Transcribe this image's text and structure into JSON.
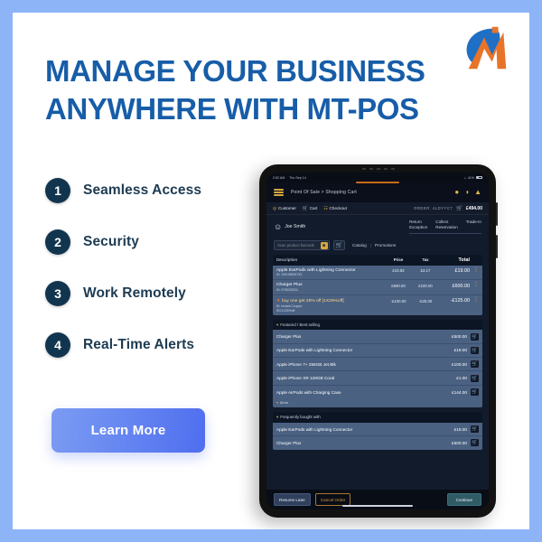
{
  "brand": {
    "logo_name": "mt-pos-logo",
    "colors": {
      "blue": "#175da8",
      "orange": "#e87722",
      "cta_blue": "#4f6ef0",
      "page_border": "#8db4f7"
    }
  },
  "headline": {
    "line1": "Manage Your Business",
    "line2": "Anywhere With MT-POS"
  },
  "features": [
    {
      "num": "1",
      "label": "Seamless Access"
    },
    {
      "num": "2",
      "label": "Security"
    },
    {
      "num": "3",
      "label": "Work Remotely"
    },
    {
      "num": "4",
      "label": "Real-Time Alerts"
    }
  ],
  "cta": {
    "label": "Learn More"
  },
  "tablet": {
    "status_bar": {
      "time": "2:52 AM",
      "date": "Thu Sep 14",
      "wifi": "wifi-icon",
      "battery": "41%"
    },
    "header": {
      "menu": "hamburger-menu-icon",
      "breadcrumb": "Point Of Sale > Shopping Cart",
      "icons": [
        "user-icon",
        "clock-icon",
        "bell-icon"
      ]
    },
    "tabs": [
      {
        "icon": "customer-icon",
        "label": "Customer"
      },
      {
        "icon": "cart-icon",
        "label": "Cart"
      },
      {
        "icon": "checkout-icon",
        "label": "Checkout"
      }
    ],
    "order": {
      "id_label": "ORDER: 4LDYYC7",
      "total": "£494.00"
    },
    "customer": {
      "name": "Joe Smith"
    },
    "right_tabs": [
      {
        "line1": "Return",
        "line2": "Exception"
      },
      {
        "line1": "Collect",
        "line2": "Reservation"
      },
      {
        "line1": "Trade-In",
        "line2": ""
      }
    ],
    "scan": {
      "placeholder": "Scan product barcode",
      "camera_icon": "camera-icon",
      "cart_icon": "cart-icon"
    },
    "links": {
      "catalog": "Catalog",
      "separator": "|",
      "promotions": "Promotions"
    },
    "cart_table": {
      "headers": {
        "description": "Description",
        "price": "Price",
        "tax": "Tax",
        "total": "Total"
      },
      "rows": [
        {
          "name": "Apple EarPods with Lightning Connector",
          "sub": "ID: 190198000733",
          "price": "£15.83",
          "tax": "£3.17",
          "total": "£19.00",
          "promo": false
        },
        {
          "name": "Charger Plus",
          "sub": "ID: 9708202911",
          "price": "£500.00",
          "tax": "£100.00",
          "total": "£600.00",
          "promo": false
        },
        {
          "name": "buy one get 25% off [1X25%off]",
          "sub": "ID: Instant Coupon",
          "sub2": "SN:1X25%off",
          "price": "-£100.00",
          "tax": "-£25.00",
          "total": "-£125.00",
          "promo": true
        }
      ]
    },
    "featured": {
      "title": "Featured / Best selling",
      "items": [
        {
          "name": "Charger Plus",
          "price": "£500.00"
        },
        {
          "name": "Apple EarPods with Lightning Connector",
          "price": "£19.00"
        },
        {
          "name": "Apple iPhone 7+ 256GB Jet Blk",
          "price": "£100.00"
        },
        {
          "name": "Apple iPhone XR 128GB Coral",
          "price": "£1.00"
        },
        {
          "name": "Apple AirPods with Charging Case",
          "price": "£144.00"
        }
      ],
      "more": "More"
    },
    "frequently": {
      "title": "Frequently bought with",
      "items": [
        {
          "name": "Apple EarPods with Lightning Connector",
          "price": "£19.00"
        },
        {
          "name": "Charger Plus",
          "price": "£500.00"
        }
      ]
    },
    "footer": {
      "resume": "Resume Later",
      "cancel": "Cancel Order",
      "continue": "Continue"
    }
  }
}
